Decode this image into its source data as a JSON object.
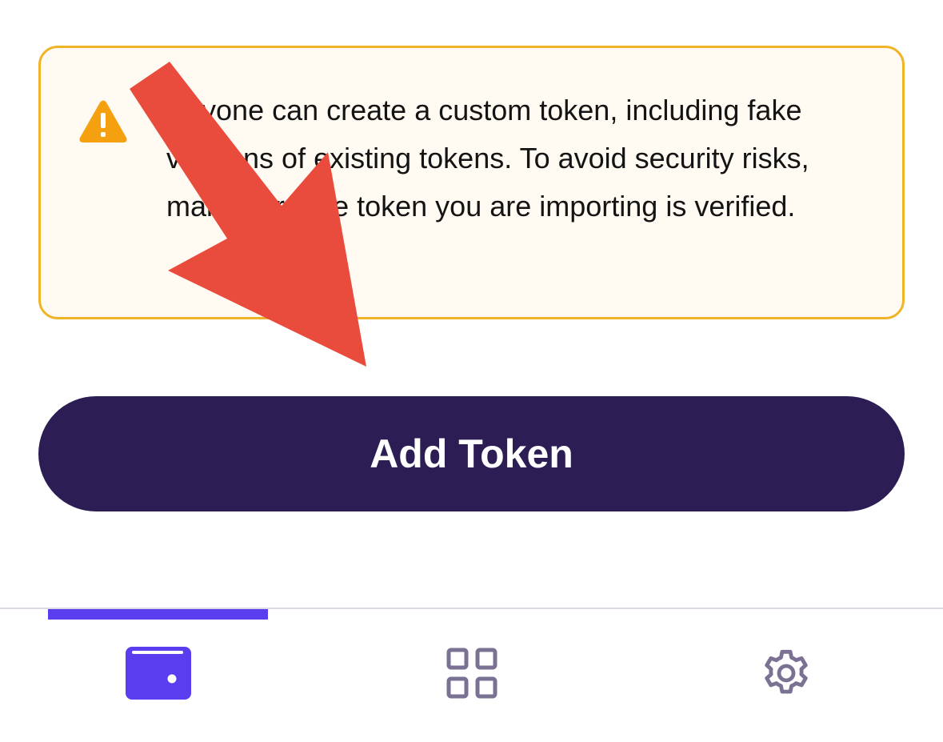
{
  "warning": {
    "icon": "warning-triangle-icon",
    "text": "Anyone can create a custom token, including fake versions of existing tokens. To avoid security risks, make sure the token you are importing is verified.",
    "colors": {
      "background": "#fffbf3",
      "border": "#f0b429",
      "icon": "#f5a10f"
    }
  },
  "add_token": {
    "label": "Add Token",
    "color": "#2c1d54"
  },
  "annotation": {
    "icon": "red-arrow-icon",
    "color": "#e94c3d"
  },
  "tab_bar": {
    "active_color": "#5b3df0",
    "inactive_color": "#7a7193",
    "tabs": [
      {
        "icon": "wallet-icon",
        "active": true
      },
      {
        "icon": "apps-grid-icon",
        "active": false
      },
      {
        "icon": "gear-icon",
        "active": false
      }
    ]
  }
}
